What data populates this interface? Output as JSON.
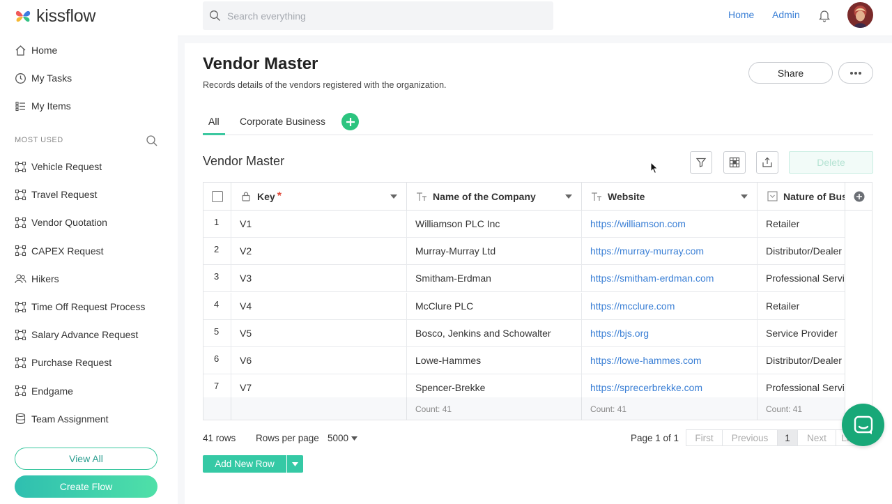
{
  "app": {
    "brand": "kissflow"
  },
  "sidebar": {
    "top_items": [
      {
        "label": "Home",
        "icon": "home-icon"
      },
      {
        "label": "My Tasks",
        "icon": "clock-icon"
      },
      {
        "label": "My Items",
        "icon": "list-icon"
      }
    ],
    "section_label": "MOST USED",
    "most_used": [
      {
        "label": "Vehicle Request",
        "icon": "flow-icon"
      },
      {
        "label": "Travel Request",
        "icon": "flow-icon"
      },
      {
        "label": "Vendor Quotation",
        "icon": "flow-icon"
      },
      {
        "label": "CAPEX Request",
        "icon": "flow-icon"
      },
      {
        "label": "Hikers",
        "icon": "users-icon"
      },
      {
        "label": "Time Off Request Process",
        "icon": "flow-icon"
      },
      {
        "label": "Salary Advance Request",
        "icon": "flow-icon"
      },
      {
        "label": "Purchase Request",
        "icon": "flow-icon"
      },
      {
        "label": "Endgame",
        "icon": "flow-icon"
      },
      {
        "label": "Team Assignment",
        "icon": "database-icon"
      }
    ],
    "view_all_label": "View All",
    "create_flow_label": "Create Flow"
  },
  "topbar": {
    "search_placeholder": "Search everything",
    "home_link": "Home",
    "admin_link": "Admin"
  },
  "page": {
    "title": "Vendor Master",
    "subtitle": "Records details of the vendors registered with the organization.",
    "share_label": "Share",
    "tabs": [
      {
        "label": "All",
        "active": true
      },
      {
        "label": "Corporate Business",
        "active": false
      }
    ],
    "section_title": "Vendor Master",
    "delete_label": "Delete"
  },
  "table": {
    "columns": [
      {
        "label": "Key",
        "required": true,
        "icon": "lock-icon"
      },
      {
        "label": "Name of the Company",
        "required": false,
        "icon": "text-field-icon"
      },
      {
        "label": "Website",
        "required": false,
        "icon": "text-field-icon"
      },
      {
        "label": "Nature of Business",
        "required": false,
        "icon": "dropdown-field-icon"
      }
    ],
    "rows": [
      {
        "n": "1",
        "key": "V1",
        "company": "Williamson PLC Inc",
        "website": "https://williamson.com",
        "nature": "Retailer"
      },
      {
        "n": "2",
        "key": "V2",
        "company": "Murray-Murray Ltd",
        "website": "https://murray-murray.com",
        "nature": "Distributor/Dealer"
      },
      {
        "n": "3",
        "key": "V3",
        "company": "Smitham-Erdman",
        "website": "https://smitham-erdman.com",
        "nature": "Professional Services"
      },
      {
        "n": "4",
        "key": "V4",
        "company": "McClure PLC",
        "website": "https://mcclure.com",
        "nature": "Retailer"
      },
      {
        "n": "5",
        "key": "V5",
        "company": "Bosco, Jenkins and Schowalter",
        "website": "https://bjs.org",
        "nature": "Service Provider"
      },
      {
        "n": "6",
        "key": "V6",
        "company": "Lowe-Hammes",
        "website": "https://lowe-hammes.com",
        "nature": "Distributor/Dealer"
      },
      {
        "n": "7",
        "key": "V7",
        "company": "Spencer-Brekke",
        "website": "https://sprecerbrekke.com",
        "nature": "Professional Services"
      }
    ],
    "footer_counts": [
      "Count: 41",
      "Count: 41",
      "Count: 41"
    ]
  },
  "pager": {
    "rows_count": "41 rows",
    "rows_per_page_label": "Rows per page",
    "rows_per_page_value": "5000",
    "page_of": "Page 1 of 1",
    "first": "First",
    "previous": "Previous",
    "current": "1",
    "next": "Next",
    "last": "Last"
  },
  "actions": {
    "add_new_row": "Add New Row"
  },
  "colors": {
    "accent": "#3cc8a0",
    "link": "#3a7fd5",
    "chat": "#18a878"
  }
}
